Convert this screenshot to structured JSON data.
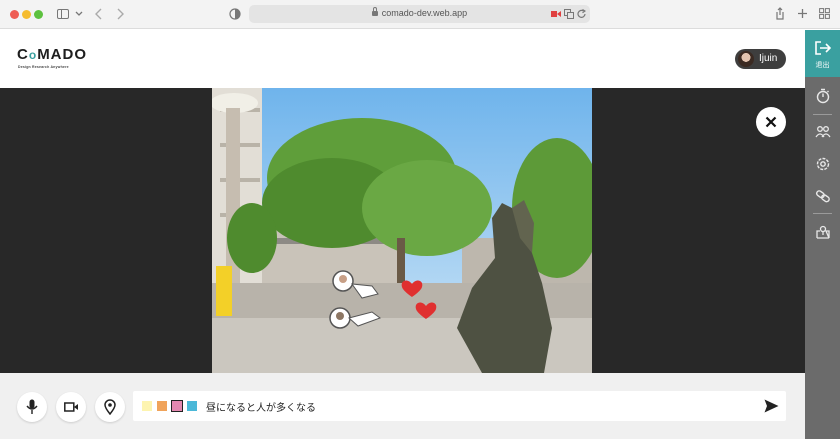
{
  "browser": {
    "url": "comado-dev.web.app"
  },
  "header": {
    "logo_text_a": "C",
    "logo_text_o": "o",
    "logo_text_b": "MADO",
    "logo_subtitle": "Design Research Anywhere",
    "user_name": "Ijuin"
  },
  "sidebar": {
    "exit_label": "退出",
    "items": [
      "timer-icon",
      "participants-icon",
      "settings-icon",
      "link-icon",
      "map-icon"
    ]
  },
  "stage": {
    "photo_alt_icon": "street-scene-photo",
    "annotations": [
      "avatar-pointer",
      "heart",
      "heart",
      "avatar-pointer"
    ]
  },
  "comment": {
    "text": "昼になると人が多くなる",
    "swatches": [
      "#fdf4b0",
      "#f0a35a",
      "#e488b0",
      "#4bb8d8"
    ],
    "selected_swatch": 2
  },
  "colors": {
    "accent": "#3aa0a0",
    "heart": "#e03030",
    "sidebar_bg": "#6b6b6b"
  }
}
